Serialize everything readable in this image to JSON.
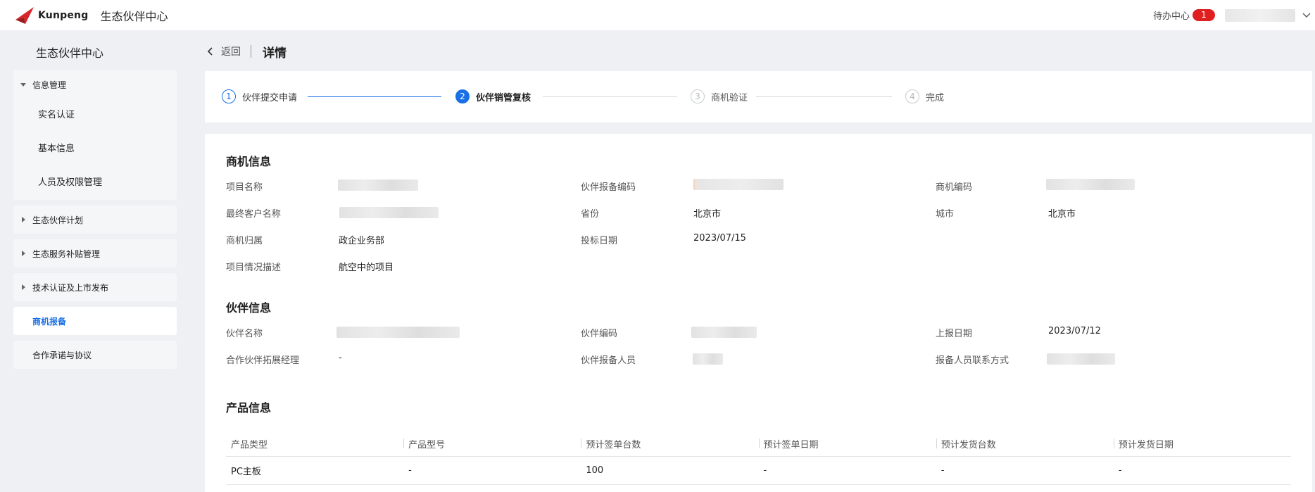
{
  "header": {
    "logo_text": "Kunpeng",
    "app_title": "生态伙伴中心",
    "todo_label": "待办中心",
    "todo_count": "1",
    "user_menu_icon": "chevron-down-icon"
  },
  "sidebar": {
    "title": "生态伙伴中心",
    "groups": [
      {
        "label": "信息管理",
        "expanded": true,
        "items": [
          "实名认证",
          "基本信息",
          "人员及权限管理"
        ]
      },
      {
        "label": "生态伙伴计划",
        "expanded": false
      },
      {
        "label": "生态服务补贴管理",
        "expanded": false
      },
      {
        "label": "技术认证及上市发布",
        "expanded": false
      },
      {
        "label": "商机报备",
        "active": true
      },
      {
        "label": "合作承诺与协议"
      }
    ]
  },
  "breadcrumb": {
    "back_label": "返回",
    "title": "详情"
  },
  "steps": [
    {
      "num": "1",
      "label": "伙伴提交申请",
      "state": "done"
    },
    {
      "num": "2",
      "label": "伙伴销管复核",
      "state": "current"
    },
    {
      "num": "3",
      "label": "商机验证",
      "state": "pending"
    },
    {
      "num": "4",
      "label": "完成",
      "state": "pending"
    }
  ],
  "opportunity": {
    "title": "商机信息",
    "project_name_label": "项目名称",
    "partner_report_code_label": "伙伴报备编码",
    "opportunity_code_label": "商机编码",
    "end_customer_label": "最终客户名称",
    "province_label": "省份",
    "province": "北京市",
    "city_label": "城市",
    "city": "北京市",
    "owner_label": "商机归属",
    "owner": "政企业务部",
    "bid_date_label": "投标日期",
    "bid_date": "2023/07/15",
    "description_label": "项目情况描述",
    "description": "航空中的项目"
  },
  "partner": {
    "title": "伙伴信息",
    "name_label": "伙伴名称",
    "code_label": "伙伴编码",
    "report_date_label": "上报日期",
    "report_date": "2023/07/12",
    "manager_label": "合作伙伴拓展经理",
    "manager": "-",
    "reporter_label": "伙伴报备人员",
    "contact_label": "报备人员联系方式"
  },
  "product": {
    "title": "产品信息",
    "columns": [
      "产品类型",
      "产品型号",
      "预计签单台数",
      "预计签单日期",
      "预计发货台数",
      "预计发货日期"
    ],
    "rows": [
      [
        "PC主板",
        "-",
        "100",
        "-",
        "-",
        "-"
      ]
    ]
  },
  "colors": {
    "accent": "#1a6fe6",
    "badge": "#e02020",
    "background": "#eef0f4"
  }
}
